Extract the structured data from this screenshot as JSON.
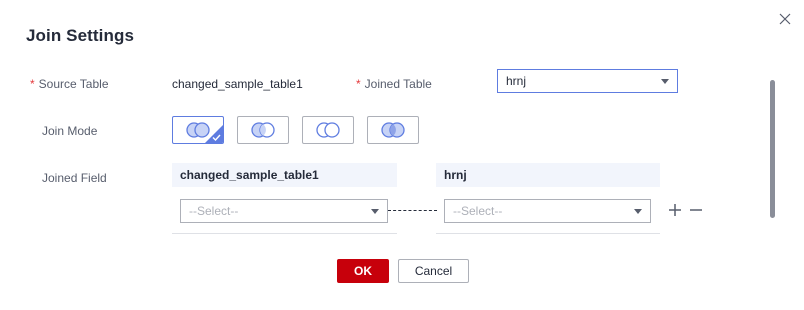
{
  "dialog": {
    "title": "Join Settings",
    "close_icon": "close-icon"
  },
  "form": {
    "source_table_label": "Source Table",
    "source_table_value": "changed_sample_table1",
    "joined_table_label": "Joined Table",
    "joined_table_value": "hrnj",
    "join_mode_label": "Join Mode",
    "join_modes": [
      {
        "icon": "inner-join-icon",
        "selected": true
      },
      {
        "icon": "left-join-icon",
        "selected": false
      },
      {
        "icon": "right-join-icon",
        "selected": false
      },
      {
        "icon": "full-join-icon",
        "selected": false
      }
    ],
    "joined_field_label": "Joined Field",
    "left_column_header": "changed_sample_table1",
    "right_column_header": "hrnj",
    "left_field_placeholder": "--Select--",
    "right_field_placeholder": "--Select--"
  },
  "actions": {
    "ok_label": "OK",
    "cancel_label": "Cancel"
  },
  "colors": {
    "accent": "#5e7ce0",
    "primary_button": "#c7000b",
    "required_mark": "#e4393c"
  }
}
